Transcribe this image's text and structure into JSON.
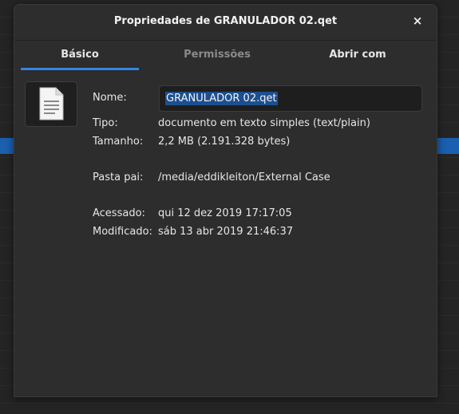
{
  "window": {
    "title": "Propriedades de GRANULADOR 02.qet",
    "close_glyph": "×"
  },
  "tabs": [
    {
      "label": "Básico",
      "active": true
    },
    {
      "label": "Permissões",
      "active": false
    },
    {
      "label": "Abrir com",
      "active": false
    }
  ],
  "icon": "text-document-icon",
  "fields": {
    "nome_label": "Nome:",
    "nome_value": "GRANULADOR 02.qet",
    "tipo_label": "Tipo:",
    "tipo_value": "documento em texto simples (text/plain)",
    "tamanho_label": "Tamanho:",
    "tamanho_value": "2,2 MB (2.191.328 bytes)",
    "pasta_label": "Pasta pai:",
    "pasta_value": "/media/eddikleiton/External Case",
    "acessado_label": "Acessado:",
    "acessado_value": "qui 12 dez 2019 17:17:05",
    "modificado_label": "Modificado:",
    "modificado_value": "sáb 13 abr 2019 21:46:37"
  },
  "colors": {
    "accent": "#3584e4",
    "selection": "#1d4f8f",
    "dialog_bg": "#2d2d2d"
  }
}
